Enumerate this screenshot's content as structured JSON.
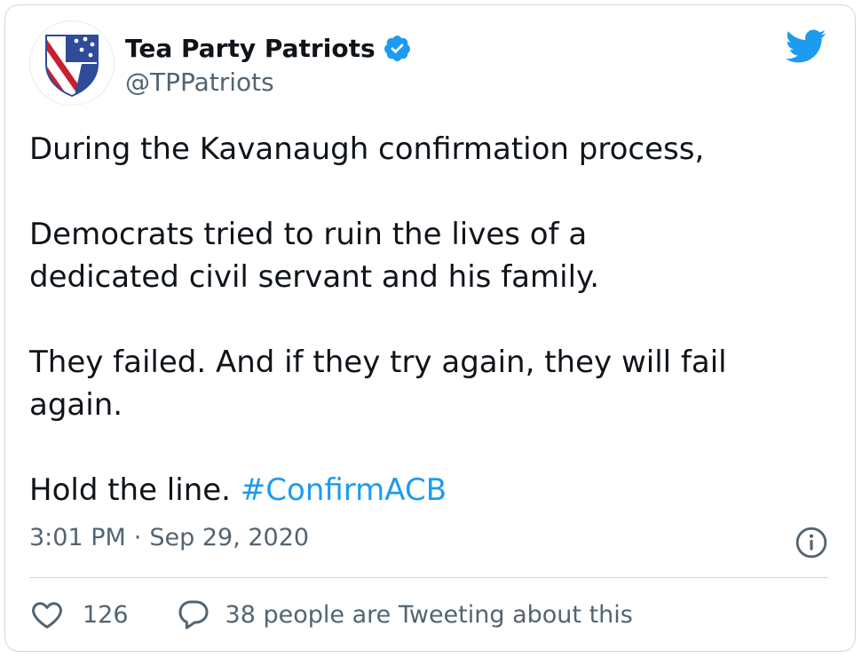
{
  "author": {
    "display_name": "Tea Party Patriots",
    "handle": "@TPPatriots",
    "verified": true,
    "avatar_icon": "shield-flag-icon"
  },
  "tweet": {
    "paragraphs": [
      "During the Kavanaugh confirmation process,",
      "Democrats tried to ruin the lives of a dedicated civil servant and his family.",
      "They failed. And if they try again, they will fail again."
    ],
    "last_line_prefix": "Hold the line.",
    "hashtag": "#ConfirmACB"
  },
  "meta": {
    "time": "3:01 PM",
    "separator": "·",
    "date": "Sep 29, 2020"
  },
  "footer": {
    "like_count": "126",
    "discussion_label": "38 people are Tweeting about this"
  },
  "colors": {
    "accent": "#1d9bf0",
    "text": "#0f1419",
    "secondary": "#536471",
    "border": "#cfd9de"
  }
}
